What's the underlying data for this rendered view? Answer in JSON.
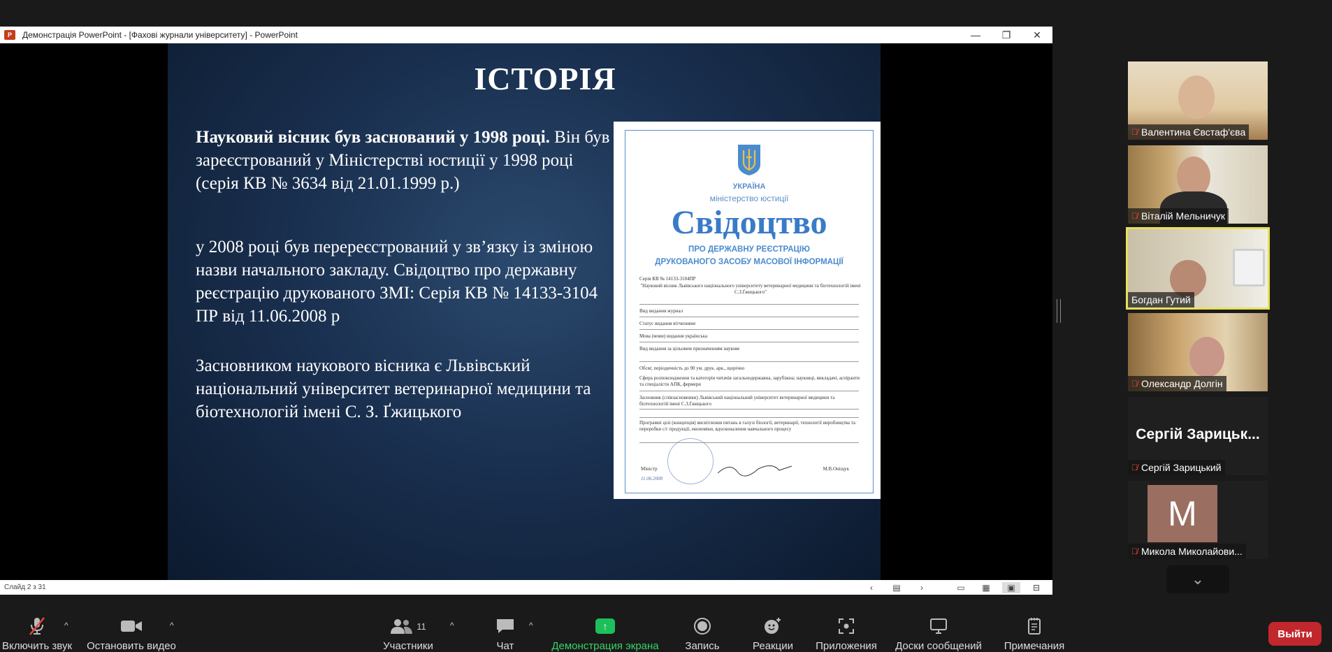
{
  "window": {
    "title": "Демонстрація PowerPoint - [Фахові журнали університету] - PowerPoint",
    "logo_text": "P",
    "minimize": "—",
    "restore": "❐",
    "close": "✕"
  },
  "slide": {
    "title": "ІСТОРІЯ",
    "para1_bold": "Науковий вісник був заснований у 1998 році.",
    "para1_rest": "Він був зареєстрований у Міністерстві юстиції у 1998 році (серія КВ № 3634 від 21.01.1999 р.)",
    "para2": "у 2008 році був перереєстрований у зв’язку із зміною назви начального закладу. Свідоцтво про державну реєстрацію друкованого ЗМІ: Серія КВ № 14133-3104 ПР від 11.06.2008 р",
    "para3": "Засновником наукового вісника є Львівський національний університет ветеринарної медицини та біотехнологій імені С. З. Ґжицького"
  },
  "certificate": {
    "country": "УКРАЇНА",
    "ministry": "міністерство юстиції",
    "heading": "Свідоцтво",
    "subheading1": "ПРО ДЕРЖАВНУ РЕЄСТРАЦІЮ",
    "subheading2": "ДРУКОВАНОГО ЗАСОБУ МАСОВОЇ ІНФОРМАЦІЇ",
    "series": "Серія КВ   № 14133-3104ПР",
    "name": "\"Науковий вісник Львівського національного університету ветеринарної медицини та біотехнологій імені С.З.Ґжицького\"",
    "kind": "Вид видання   журнал",
    "status": "Статус видання   вітчизняне",
    "language": "Мова (мови) видання   українська",
    "purpose": "Вид видання за цільовим призначенням   наукове",
    "volume": "Обсяг, періодичність   до 90 ум. друк. арк., щорічно",
    "sphere": "Сфера розповсюдження та категорія читачів   загальнодержавна, зарубіжна; науковці, викладачі, аспіранти та спеціалісти АПК, фермери",
    "founder": "Засновник (співзасновники)   Львівський національний університет ветеринарної медицини та біотехнологій імені С.З.Ґжицького",
    "program": "Програмні цілі (концепція)   висвітлення питань в галузі біології, ветеринарії, технології виробництва та переробки с/г продукції, економіки, вдосконалення навчального процесу",
    "minister_label": "Міністр",
    "minister_name": "М.В.Оніщук",
    "date": "11.06.2008"
  },
  "statusbar": {
    "slide_counter": "Слайд 2 з 31",
    "prev": "‹",
    "notes": "▤",
    "next": "›",
    "view_normal": "▭",
    "view_sorter": "▦",
    "view_reading": "▣",
    "view_slideshow": "⊟"
  },
  "participants": [
    {
      "name": "Валентина Євстаф'єва"
    },
    {
      "name": "Віталій Мельничук"
    },
    {
      "name": "Богдан Гутий"
    },
    {
      "name": "Олександр Долгін"
    },
    {
      "name": "Сергій Зарицький",
      "display": "Сергій Зарицьк..."
    },
    {
      "name": "Микола Миколайови...",
      "initial": "M"
    }
  ],
  "toolbar": {
    "mute_label": "Включить звук",
    "video_label": "Остановить видео",
    "participants_label": "Участники",
    "participants_count": "11",
    "chat_label": "Чат",
    "share_label": "Демонстрация экрана",
    "record_label": "Запись",
    "reactions_label": "Реакции",
    "apps_label": "Приложения",
    "whiteboard_label": "Доски сообщений",
    "notes_label": "Примечания",
    "leave_label": "Выйти"
  },
  "colors": {
    "share_green": "#1dbf5a",
    "leave_red": "#c1272d",
    "active_speaker": "#e8e05a",
    "cert_blue": "#3a7bc8"
  }
}
